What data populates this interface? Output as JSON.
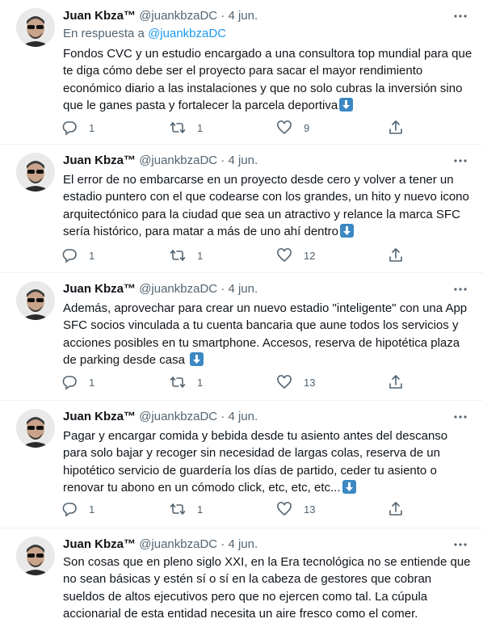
{
  "tweets": [
    {
      "name": "Juan Kbza™",
      "handle": "@juankbzaDC",
      "date": "4 jun.",
      "separator": "·",
      "reply_prefix": "En respuesta a ",
      "reply_to": "@juankbzaDC",
      "text": "Fondos CVC y un estudio encargado a una consultora top mundial para que te diga cómo debe ser el proyecto para sacar el mayor rendimiento económico diario a las instalaciones y que no solo cubras la inversión sino que le ganes pasta y fortalecer la parcela deportiva",
      "replies": "1",
      "retweets": "1",
      "likes": "9"
    },
    {
      "name": "Juan Kbza™",
      "handle": "@juankbzaDC",
      "date": "4 jun.",
      "separator": "·",
      "text": "El error de no embarcarse en un proyecto desde cero y volver a tener un estadio puntero con el que codearse con los grandes, un hito y nuevo icono arquitectónico para la ciudad que sea un atractivo y relance la marca SFC sería histórico, para matar a más de uno ahí dentro",
      "replies": "1",
      "retweets": "1",
      "likes": "12"
    },
    {
      "name": "Juan Kbza™",
      "handle": "@juankbzaDC",
      "date": "4 jun.",
      "separator": "·",
      "text": "Además, aprovechar para crear un nuevo estadio \"inteligente\" con una App SFC socios vinculada a tu cuenta bancaria que aune todos los servicios y acciones posibles en tu smartphone. Accesos, reserva de hipotética plaza de parking desde casa",
      "replies": "1",
      "retweets": "1",
      "likes": "13"
    },
    {
      "name": "Juan Kbza™",
      "handle": "@juankbzaDC",
      "date": "4 jun.",
      "separator": "·",
      "text": "Pagar y encargar comida y bebida desde tu asiento antes del descanso para solo bajar y recoger sin necesidad de largas colas, reserva de un hipotético servicio de guardería los días de partido, ceder tu asiento o renovar tu abono en un cómodo click, etc, etc, etc...",
      "replies": "1",
      "retweets": "1",
      "likes": "13"
    },
    {
      "name": "Juan Kbza™",
      "handle": "@juankbzaDC",
      "date": "4 jun.",
      "separator": "·",
      "text": "Son cosas que en pleno siglo XXI, en la Era tecnológica no se entiende que no sean básicas y estén sí o sí en la cabeza de gestores que cobran sueldos de altos ejecutivos pero que no ejercen como tal. La cúpula accionarial de esta entidad necesita un aire fresco como el comer."
    }
  ],
  "icons": {
    "avatar": "avatar-man-sunglasses",
    "more": "more-dots-icon",
    "reply": "reply-bubble-icon",
    "retweet": "retweet-arrows-icon",
    "like": "heart-icon",
    "share": "share-upload-icon",
    "down_arrow": "down-arrow-emoji"
  },
  "colors": {
    "text": "#0f1419",
    "muted": "#536471",
    "link": "#1d9bf0",
    "divider": "#eff3f4",
    "emoji_blue": "#3b88c3"
  }
}
